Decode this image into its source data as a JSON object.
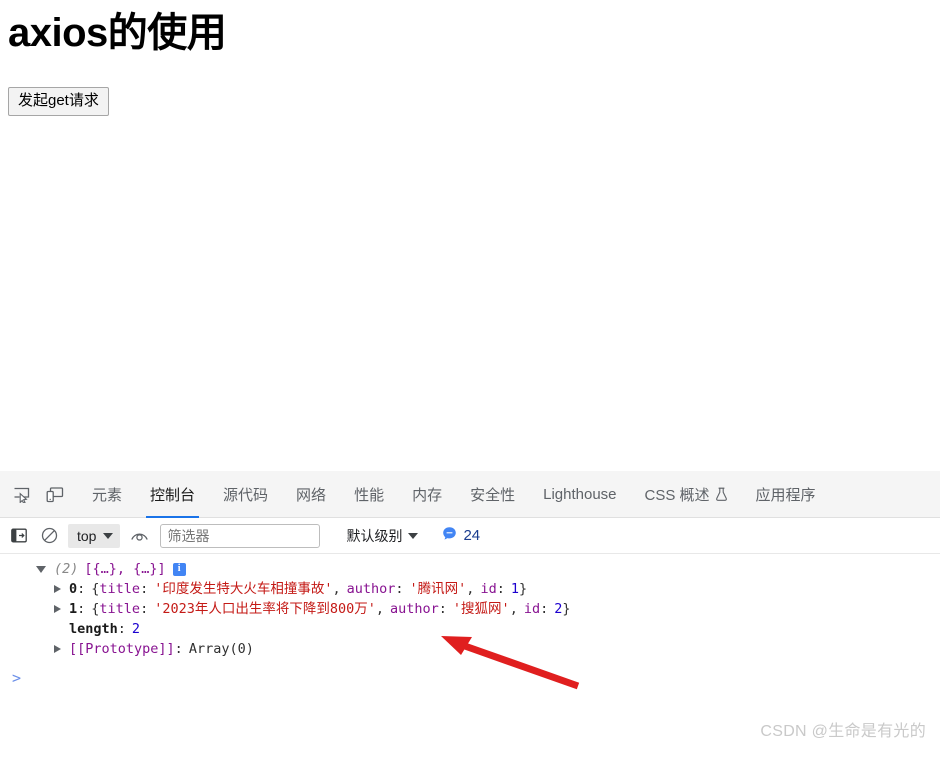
{
  "page": {
    "title": "axios的使用",
    "get_button_label": "发起get请求"
  },
  "devtools": {
    "left_icons": [
      {
        "name": "inspect-element-icon",
        "label": "inspect-element-icon"
      },
      {
        "name": "device-toolbar-icon",
        "label": "device-toolbar-icon"
      }
    ],
    "tabs": [
      {
        "label": "元素",
        "active": false
      },
      {
        "label": "控制台",
        "active": true
      },
      {
        "label": "源代码",
        "active": false
      },
      {
        "label": "网络",
        "active": false
      },
      {
        "label": "性能",
        "active": false
      },
      {
        "label": "内存",
        "active": false
      },
      {
        "label": "安全性",
        "active": false
      },
      {
        "label": "Lighthouse",
        "active": false
      },
      {
        "label": "CSS 概述",
        "active": false,
        "icon": "flask-icon"
      },
      {
        "label": "应用程序",
        "active": false
      }
    ],
    "active_tab_color": "#1a73e8",
    "toolbar": {
      "sidebar_toggle_icon": "show-console-sidebar-icon",
      "clear_console_icon": "clear-console-icon",
      "context_selector_value": "top",
      "eye_icon": "live-expression-icon",
      "filter_placeholder": "筛选器",
      "filter_value": "",
      "level_selector_value": "默认级别",
      "message_count": "24",
      "message_count_icon": "info-message-icon"
    },
    "console": {
      "prompt_symbol": ">",
      "array_row": {
        "count": "(2)",
        "preview": "[{…}, {…}]",
        "badge": "i"
      },
      "entries": [
        {
          "index": "0",
          "sep": ":",
          "open": "{",
          "key1": "title",
          "val1": "'印度发生特大火车相撞事故'",
          "key2": "author",
          "val2": "'腾讯网'",
          "key3": "id",
          "val3": "1",
          "close": "}"
        },
        {
          "index": "1",
          "sep": ":",
          "open": "{",
          "key1": "title",
          "val1": "'2023年人口出生率将下降到800万'",
          "key2": "author",
          "val2": "'搜狐网'",
          "key3": "id",
          "val3": "2",
          "close": "}"
        }
      ],
      "length_key": "length",
      "length_value": "2",
      "proto_key": "[[Prototype]]",
      "proto_value": "Array(0)"
    }
  },
  "annotation": {
    "arrow_color": "#e01f1f",
    "arrow_name": "red-pointer-arrow"
  },
  "watermark": {
    "text": "CSDN @生命是有光的"
  }
}
